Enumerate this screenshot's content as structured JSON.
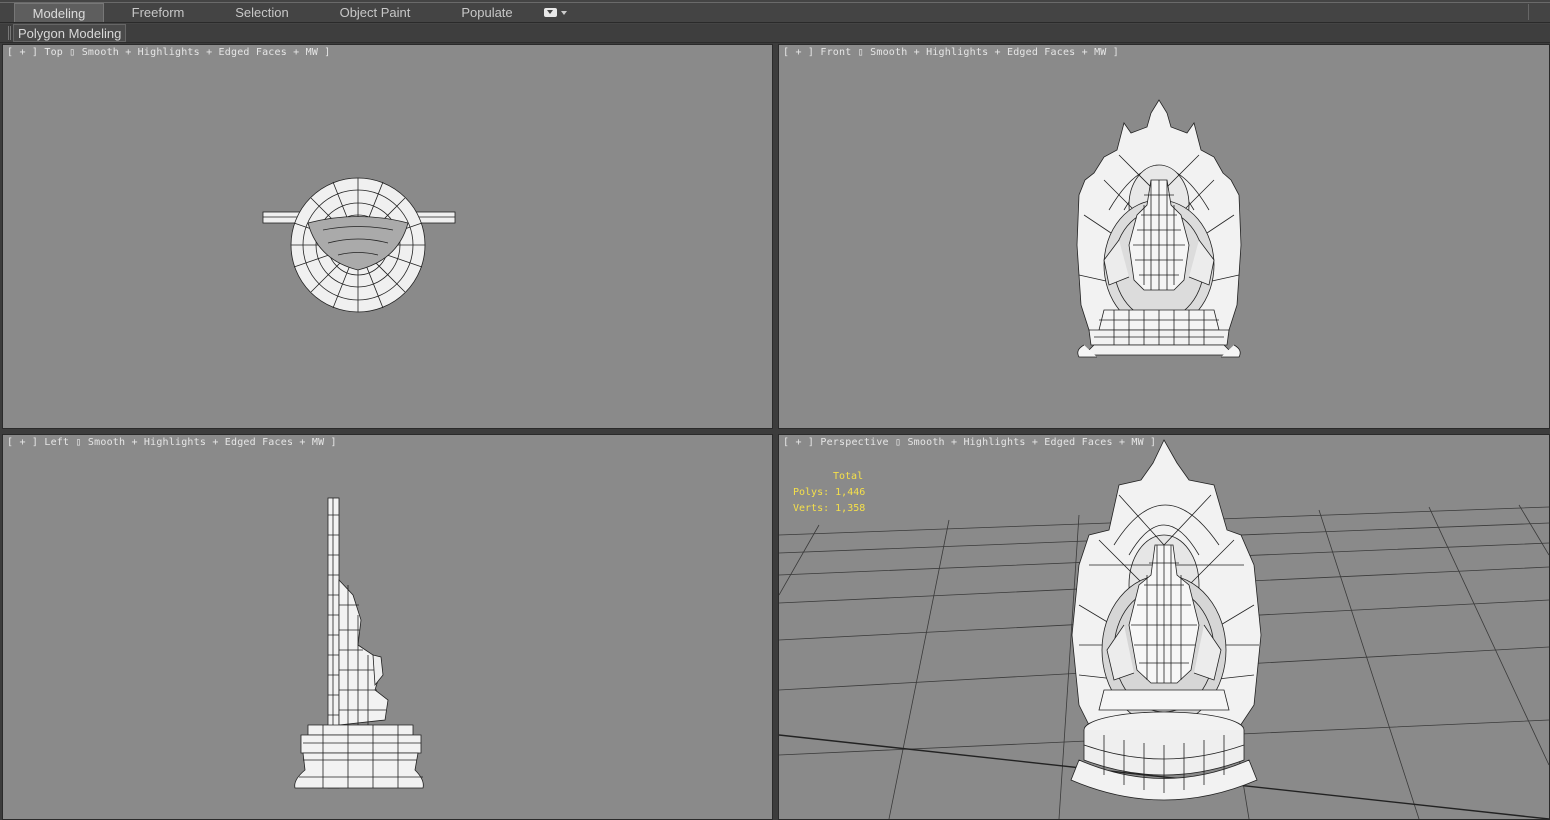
{
  "ribbon": {
    "tabs": [
      {
        "label": "Modeling",
        "active": true
      },
      {
        "label": "Freeform",
        "active": false
      },
      {
        "label": "Selection",
        "active": false
      },
      {
        "label": "Object Paint",
        "active": false
      },
      {
        "label": "Populate",
        "active": false
      }
    ],
    "panel_label": "Polygon Modeling"
  },
  "viewports": {
    "top": {
      "plus": "[ + ]",
      "view": "Top",
      "shading": "Smooth + Highlights + Edged Faces + MW ]"
    },
    "front": {
      "plus": "[ + ]",
      "view": "Front",
      "shading": "Smooth + Highlights + Edged Faces + MW ]"
    },
    "left": {
      "plus": "[ + ]",
      "view": "Left",
      "shading": "Smooth + Highlights + Edged Faces + MW ]"
    },
    "perspective": {
      "plus": "[ + ]",
      "view": "Perspective",
      "shading": "Smooth + Highlights + Edged Faces + MW ]",
      "stats": {
        "header": "Total",
        "polys_label": "Polys:",
        "polys": "1,446",
        "verts_label": "Verts:",
        "verts": "1,358"
      }
    }
  },
  "colors": {
    "viewport_bg": "#8a8a8a",
    "stats_text": "#f5e04a",
    "mesh_fill": "#f2f2f2",
    "mesh_edge": "#222222",
    "grid_line": "#3a3a3a"
  },
  "icons": [
    "ribbon-dropdown-icon"
  ]
}
